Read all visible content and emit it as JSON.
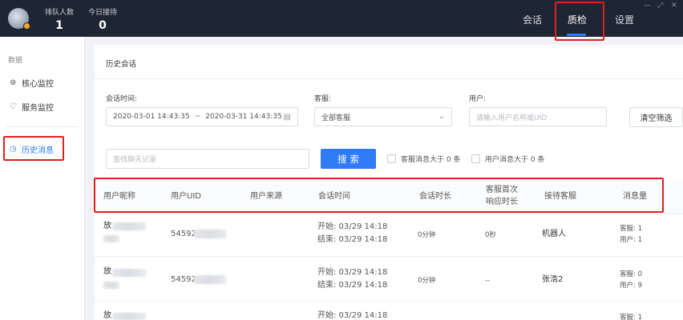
{
  "header": {
    "stats": [
      {
        "label": "排队人数",
        "value": "1"
      },
      {
        "label": "今日接待",
        "value": "0"
      }
    ],
    "nav": [
      {
        "label": "会话"
      },
      {
        "label": "质检"
      },
      {
        "label": "设置"
      }
    ],
    "window_controls": {
      "min": "—",
      "max": "⤢",
      "close": "✕"
    }
  },
  "sidebar": {
    "section_label": "数据",
    "items": [
      {
        "label": "核心监控",
        "icon": "dashboard-icon"
      },
      {
        "label": "服务监控",
        "icon": "service-icon"
      },
      {
        "label": "历史消息",
        "icon": "clock-icon"
      }
    ]
  },
  "main": {
    "title": "历史会话",
    "filters": {
      "session_time_label": "会话时间:",
      "date_start": "2020-03-01 14:43:35",
      "date_sep": "~",
      "date_end": "2020-03-31 14:43:35",
      "agent_label": "客服:",
      "agent_value": "全部客服",
      "user_label": "用户:",
      "user_placeholder": "请输入用户名称或UID",
      "clear_label": "清空筛选",
      "search_placeholder": "查找聊天记录",
      "search_label": "搜索",
      "agent_msg_check": "客服消息大于 0 条",
      "user_msg_check": "用户消息大于 0 条"
    },
    "table": {
      "headers": [
        "用户昵称",
        "用户UID",
        "用户来源",
        "会话时间",
        "会话时长",
        "客服首次响应时长",
        "接待客服",
        "消息量"
      ],
      "header_line1": "客服首次",
      "header_line2": "响应时长",
      "rows": [
        {
          "nick": "放",
          "uid": "54592",
          "start": "开始:  03/29 14:18",
          "end": "结束:  03/29 14:18",
          "duration": "0分钟",
          "first_resp": "0秒",
          "agent": "机器人",
          "agent_msgs": "客服: 1",
          "user_msgs": "用户: 1"
        },
        {
          "nick": "放",
          "uid": "54592",
          "start": "开始:  03/29 14:18",
          "end": "结束:  03/29 14:18",
          "duration": "0分钟",
          "first_resp": "--",
          "agent": "张浩2",
          "agent_msgs": "客服: 0",
          "user_msgs": "用户: 9"
        },
        {
          "nick": "放",
          "uid": "",
          "start": "开始:  03/29 14:18",
          "end": "",
          "duration": "",
          "first_resp": "",
          "agent": "",
          "agent_msgs": "客服: 1",
          "user_msgs": ""
        }
      ]
    }
  },
  "colors": {
    "accent": "#2f7cf6",
    "topbar": "#1f2633",
    "highlight": "#e02020"
  }
}
